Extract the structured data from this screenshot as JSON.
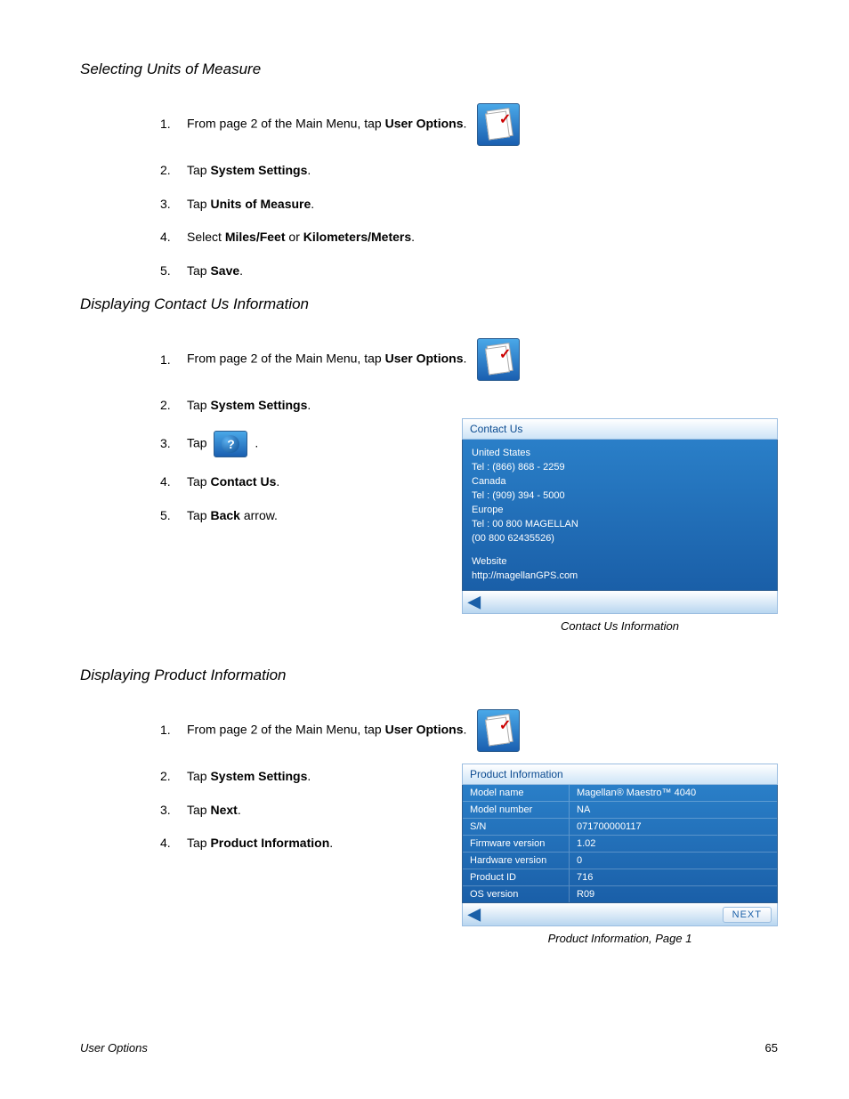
{
  "sections": {
    "units": {
      "heading": "Selecting Units of Measure",
      "steps": [
        {
          "num": "1.",
          "pre": "From page 2 of the Main Menu, tap ",
          "bold": "User Options",
          "post": "."
        },
        {
          "num": "2.",
          "pre": "Tap ",
          "bold": "System Settings",
          "post": "."
        },
        {
          "num": "3.",
          "pre": "Tap ",
          "bold": "Units of Measure",
          "post": "."
        },
        {
          "num": "4.",
          "pre": "Select ",
          "bold": "Miles/Feet",
          "mid": " or ",
          "bold2": "Kilometers/Meters",
          "post": "."
        },
        {
          "num": "5.",
          "pre": "Tap ",
          "bold": "Save",
          "post": "."
        }
      ]
    },
    "contact": {
      "heading": "Displaying Contact Us Information",
      "steps": [
        {
          "num": "1.",
          "pre": "From page 2 of the Main Menu, tap ",
          "bold": "User Options",
          "post": "."
        },
        {
          "num": "2.",
          "pre": "Tap ",
          "bold": "System Settings",
          "post": "."
        },
        {
          "num": "3.",
          "pre": "Tap ",
          "post": "."
        },
        {
          "num": "4.",
          "pre": "Tap ",
          "bold": "Contact Us",
          "post": "."
        },
        {
          "num": "5.",
          "pre": "Tap ",
          "bold": "Back",
          "post": " arrow."
        }
      ]
    },
    "product": {
      "heading": "Displaying Product Information",
      "steps": [
        {
          "num": "1.",
          "pre": "From page 2 of the Main Menu, tap ",
          "bold": "User Options",
          "post": "."
        },
        {
          "num": "2.",
          "pre": "Tap ",
          "bold": "System Settings",
          "post": "."
        },
        {
          "num": "3.",
          "pre": "Tap ",
          "bold": "Next",
          "post": "."
        },
        {
          "num": "4.",
          "pre": "Tap ",
          "bold": "Product Information",
          "post": "."
        }
      ]
    }
  },
  "screenshot_contact": {
    "header": "Contact Us",
    "lines": [
      "United States",
      "Tel : (866) 868 - 2259",
      "Canada",
      "Tel : (909) 394 - 5000",
      "Europe",
      "Tel : 00 800 MAGELLAN",
      "(00 800 62435526)",
      "",
      "Website",
      "http://magellanGPS.com"
    ],
    "caption": "Contact Us Information"
  },
  "screenshot_product": {
    "header": "Product Information",
    "rows": [
      {
        "k": "Model name",
        "v": "Magellan® Maestro™ 4040"
      },
      {
        "k": "Model number",
        "v": "NA"
      },
      {
        "k": "S/N",
        "v": "071700000117"
      },
      {
        "k": "Firmware version",
        "v": "1.02"
      },
      {
        "k": "Hardware version",
        "v": "0"
      },
      {
        "k": "Product ID",
        "v": "716"
      },
      {
        "k": "OS version",
        "v": "R09"
      }
    ],
    "next": "NEXT",
    "caption": "Product Information, Page 1"
  },
  "footer": {
    "left": "User Options",
    "right": "65"
  }
}
